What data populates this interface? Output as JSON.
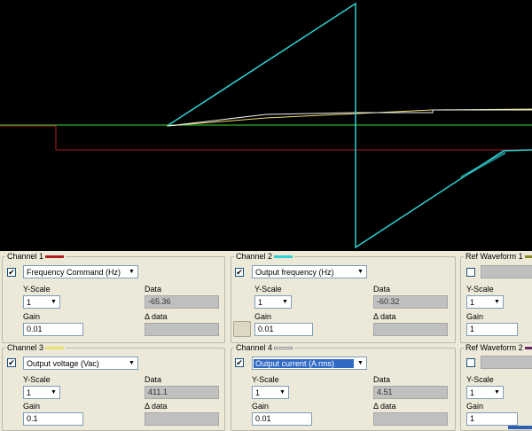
{
  "colors": {
    "scope_background": "#000000",
    "channel1": "#b01e1e",
    "channel2": "#2ed2d6",
    "channel3": "#e8e070",
    "channel4": "#ffffff",
    "ref1": "#8a8a20",
    "ref2": "#6a2a6a",
    "baseline": "#2bb02b",
    "selection": "#316ac5"
  },
  "channels": [
    {
      "title": "Channel 1",
      "checked": true,
      "signal": "Frequency Command (Hz)",
      "yscale_label": "Y-Scale",
      "yscale": "1",
      "data_label": "Data",
      "data": "-65.36",
      "gain_label": "Gain",
      "gain": "0.01",
      "delta_label": "Δ data",
      "delta": ""
    },
    {
      "title": "Channel 2",
      "checked": true,
      "signal": "Output frequency (Hz)",
      "yscale_label": "Y-Scale",
      "yscale": "1",
      "data_label": "Data",
      "data": "-60.32",
      "gain_label": "Gain",
      "gain": "0.01",
      "delta_label": "Δ data",
      "delta": ""
    },
    {
      "title": "Channel 3",
      "checked": true,
      "signal": "Output voltage (Vac)",
      "yscale_label": "Y-Scale",
      "yscale": "1",
      "data_label": "Data",
      "data": "411.1",
      "gain_label": "Gain",
      "gain": "0.1",
      "delta_label": "Δ data",
      "delta": ""
    },
    {
      "title": "Channel 4",
      "checked": true,
      "signal": "Output current (A rms)",
      "yscale_label": "Y-Scale",
      "yscale": "1",
      "data_label": "Data",
      "data": "4.51",
      "gain_label": "Gain",
      "gain": "0.01",
      "delta_label": "Δ data",
      "delta": ""
    }
  ],
  "refs": [
    {
      "title": "Ref Waveform 1",
      "checked": false,
      "yscale_label": "Y-Scale",
      "yscale": "1",
      "gain_label": "Gain",
      "gain": "1"
    },
    {
      "title": "Ref Waveform 2",
      "checked": false,
      "yscale_label": "Y-Scale",
      "yscale": "1",
      "gain_label": "Gain",
      "gain": "1"
    }
  ],
  "icons": {
    "checkbox": "checkmark-icon",
    "dropdown": "chevron-down-icon"
  },
  "check_mark": "✔",
  "arrow_glyph": "▼"
}
